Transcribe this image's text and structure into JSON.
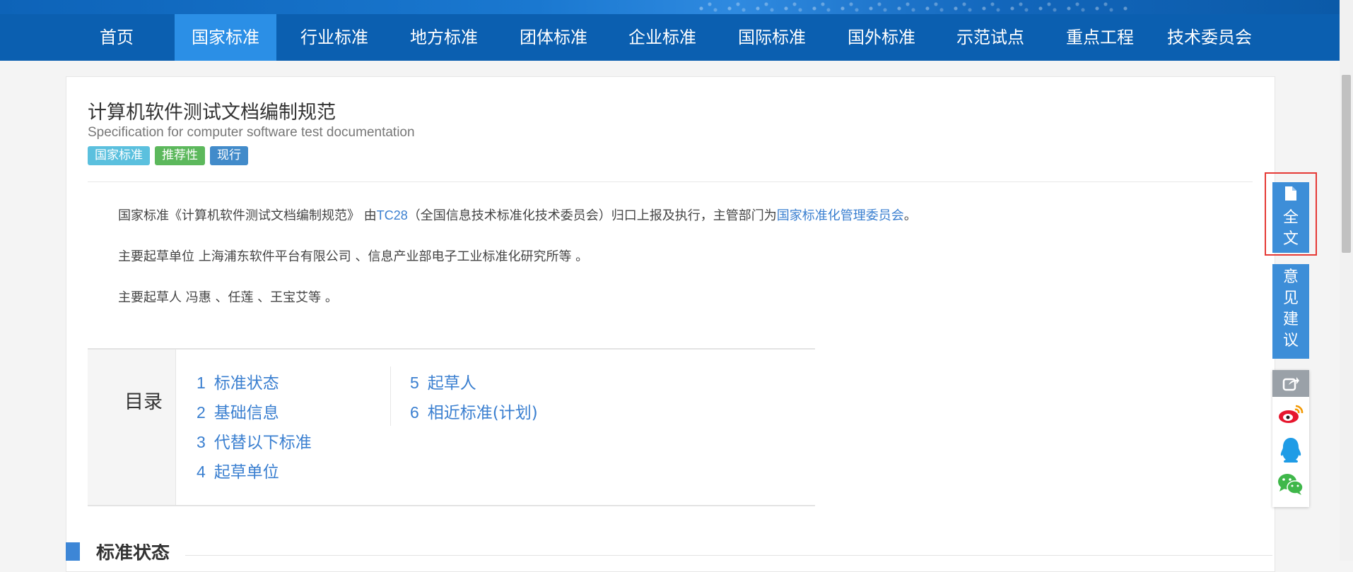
{
  "nav": {
    "items": [
      {
        "label": "首页",
        "active": false
      },
      {
        "label": "国家标准",
        "active": true
      },
      {
        "label": "行业标准",
        "active": false
      },
      {
        "label": "地方标准",
        "active": false
      },
      {
        "label": "团体标准",
        "active": false
      },
      {
        "label": "企业标准",
        "active": false
      },
      {
        "label": "国际标准",
        "active": false
      },
      {
        "label": "国外标准",
        "active": false
      },
      {
        "label": "示范试点",
        "active": false
      },
      {
        "label": "重点工程",
        "active": false
      },
      {
        "label": "技术委员会",
        "active": false
      }
    ]
  },
  "standard": {
    "title": "计算机软件测试文档编制规范",
    "subtitle": "Specification for computer software test documentation",
    "badges": [
      {
        "label": "国家标准",
        "color": "#5bc0de"
      },
      {
        "label": "推荐性",
        "color": "#5cb85c"
      },
      {
        "label": "现行",
        "color": "#428bca"
      }
    ]
  },
  "description": {
    "p1_prefix": "国家标准《计算机软件测试文档编制规范》 由",
    "p1_tc": "TC28",
    "p1_middle": "（全国信息技术标准化技术委员会）归口上报及执行，主管部门为",
    "p1_dept": "国家标准化管理委员会",
    "p1_suffix": "。",
    "p2": "主要起草单位 上海浦东软件平台有限公司 、信息产业部电子工业标准化研究所等 。",
    "p3": "主要起草人 冯惠 、任莲 、王宝艾等 。"
  },
  "toc": {
    "title": "目录",
    "items": [
      {
        "num": "1",
        "label": "标准状态"
      },
      {
        "num": "2",
        "label": "基础信息"
      },
      {
        "num": "3",
        "label": "代替以下标准"
      },
      {
        "num": "4",
        "label": "起草单位"
      },
      {
        "num": "5",
        "label": "起草人"
      },
      {
        "num": "6",
        "label": "相近标准(计划)"
      }
    ]
  },
  "section": {
    "title": "标准状态"
  },
  "tools": {
    "fulltext_chars": [
      "全",
      "文"
    ],
    "feedback_chars": [
      "意",
      "见",
      "建",
      "议"
    ],
    "share_icons": [
      "share-icon",
      "weibo-icon",
      "qq-icon",
      "wechat-icon"
    ]
  }
}
